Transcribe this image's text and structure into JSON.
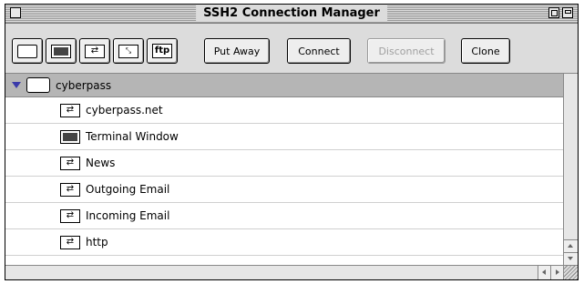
{
  "window": {
    "title": "SSH2 Connection Manager"
  },
  "toolbar": {
    "icon_buttons": [
      {
        "icon": "folder-icon"
      },
      {
        "icon": "terminal-icon"
      },
      {
        "icon": "connection-icon"
      },
      {
        "icon": "file-icon"
      },
      {
        "icon": "ftp-icon",
        "label": "ftp"
      }
    ],
    "put_away": "Put Away",
    "connect": "Connect",
    "disconnect": "Disconnect",
    "clone": "Clone"
  },
  "list": {
    "group": {
      "label": "cyberpass",
      "expanded": true
    },
    "items": [
      {
        "label": "cyberpass.net",
        "icon": "connection-icon"
      },
      {
        "label": "Terminal Window",
        "icon": "terminal-icon"
      },
      {
        "label": "News",
        "icon": "connection-icon"
      },
      {
        "label": "Outgoing Email",
        "icon": "connection-icon"
      },
      {
        "label": "Incoming Email",
        "icon": "connection-icon"
      },
      {
        "label": "http",
        "icon": "connection-icon"
      }
    ]
  },
  "colors": {
    "selection_row": "#b5b5b5",
    "disclosure_triangle": "#3a3aaa"
  }
}
